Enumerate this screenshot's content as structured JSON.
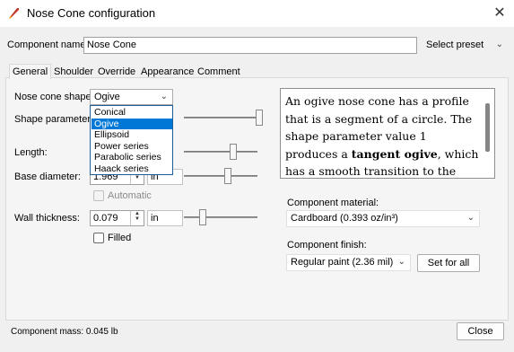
{
  "window": {
    "title": "Nose Cone configuration",
    "close_glyph": "✕"
  },
  "component_name": {
    "label": "Component name:",
    "value": "Nose Cone"
  },
  "preset": {
    "label": "Select preset"
  },
  "tabs": [
    {
      "label": "General"
    },
    {
      "label": "Shoulder"
    },
    {
      "label": "Override"
    },
    {
      "label": "Appearance"
    },
    {
      "label": "Comment"
    }
  ],
  "shape": {
    "label": "Nose cone shape:",
    "selected": "Ogive",
    "options": [
      "Conical",
      "Ogive",
      "Ellipsoid",
      "Power series",
      "Parabolic series",
      "Haack series"
    ]
  },
  "shape_parameter": {
    "label": "Shape parameter:",
    "slider_fraction": 1.0
  },
  "length": {
    "label": "Length:",
    "slider_fraction": 0.68
  },
  "base_diameter": {
    "label": "Base diameter:",
    "value": "1.969",
    "unit": "in",
    "slider_fraction": 0.6
  },
  "automatic": {
    "label": "Automatic",
    "checked": false
  },
  "wall_thickness": {
    "label": "Wall thickness:",
    "value": "0.079",
    "unit": "in",
    "slider_fraction": 0.25
  },
  "filled": {
    "label": "Filled",
    "checked": false
  },
  "description": {
    "part1": "An ogive nose cone has a profile that is a segment of a circle. The shape parameter value 1 produces a ",
    "bold": "tangent ogive",
    "part2": ", which has a smooth transition to the body tube, values less"
  },
  "material": {
    "label": "Component material:",
    "value": "Cardboard (0.393 oz/in³)"
  },
  "finish": {
    "label": "Component finish:",
    "value": "Regular paint (2.36 mil)",
    "set_all": "Set for all"
  },
  "footer": {
    "mass": "Component mass: 0.045 lb",
    "close": "Close"
  }
}
